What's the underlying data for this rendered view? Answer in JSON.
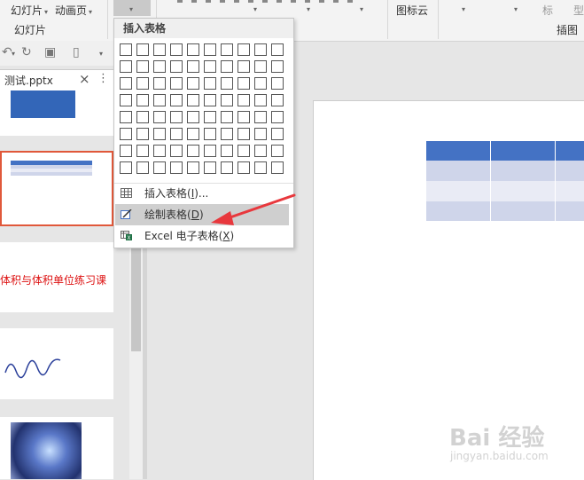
{
  "ribbon": {
    "slides_btn": "幻灯片",
    "anim_btn": "动画页",
    "group_slides": "幻灯片",
    "icon_cloud": "图标云",
    "group_insert_image": "插图",
    "label_biao": "标",
    "label_xing": "型"
  },
  "file_tab": {
    "name": "测试.pptx",
    "close": "×",
    "menu": "⋮"
  },
  "slides": {
    "thumb3_title": "体积与体积单位练习课"
  },
  "dropdown": {
    "title": "插入表格",
    "grid": {
      "columns": 10,
      "rows": 8
    },
    "items": [
      {
        "label": "插入表格(",
        "key": "I",
        "suffix": ")..."
      },
      {
        "label": "绘制表格(",
        "key": "D",
        "suffix": ")"
      },
      {
        "label": "Excel 电子表格(",
        "key": "X",
        "suffix": ")"
      }
    ],
    "highlighted_item": 1
  },
  "watermark": {
    "brand": "Bai 经验",
    "url": "jingyan.baidu.com"
  },
  "colors": {
    "table_header": "#4472c4",
    "table_row_dark": "#cfd5ea",
    "table_row_light": "#e9ebf5",
    "annotation_arrow": "#e8383d",
    "selected_thumb_border": "#e0583a"
  }
}
